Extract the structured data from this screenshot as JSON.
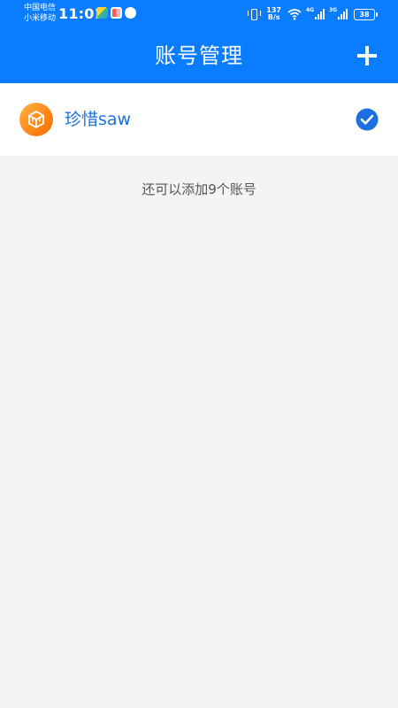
{
  "status_bar": {
    "carrier_1": "中国电信",
    "carrier_2": "小米移动",
    "time": "11:01",
    "net_speed_value": "137",
    "net_speed_unit": "B/s",
    "signal_1_tag": "4G",
    "signal_2_tag": "3G",
    "battery": "38"
  },
  "header": {
    "title": "账号管理"
  },
  "accounts": [
    {
      "name": "珍惜saw",
      "selected": true
    }
  ],
  "hint": "还可以添加9个账号",
  "colors": {
    "header_bg": "#0a7cff",
    "accent": "#1c6fe0",
    "avatar": "#ff8a1a",
    "page_bg": "#f4f4f4"
  }
}
